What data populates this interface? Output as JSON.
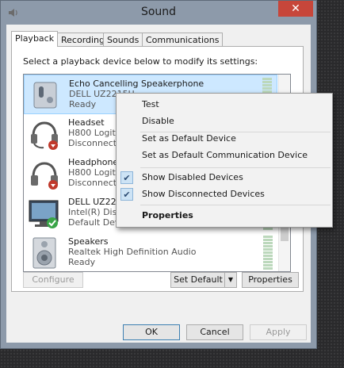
{
  "window": {
    "title": "Sound",
    "close_glyph": "✕"
  },
  "tabs": [
    {
      "label": "Playback",
      "active": true
    },
    {
      "label": "Recording"
    },
    {
      "label": "Sounds"
    },
    {
      "label": "Communications"
    }
  ],
  "instruction": "Select a playback device below to modify its settings:",
  "devices": [
    {
      "name": "Echo Cancelling Speakerphone",
      "desc": "DELL UZ2215H",
      "status": "Ready",
      "icon": "speakerphone-icon",
      "selected": true
    },
    {
      "name": "Headset",
      "desc": "H800 Logite",
      "status": "Disconnect",
      "icon": "headset-icon"
    },
    {
      "name": "Headphone",
      "desc": "H800 Logite",
      "status": "Disconnect",
      "icon": "headphones-icon"
    },
    {
      "name": "DELL UZ221",
      "desc": "Intel(R) Disp",
      "status": "Default Device",
      "icon": "monitor-icon"
    },
    {
      "name": "Speakers",
      "desc": "Realtek High Definition Audio",
      "status": "Ready",
      "icon": "speakers-icon"
    }
  ],
  "context_menu": {
    "test": "Test",
    "disable": "Disable",
    "set_default": "Set as Default Device",
    "set_default_comm": "Set as Default Communication Device",
    "show_disabled": "Show Disabled Devices",
    "show_disconnected": "Show Disconnected Devices",
    "properties": "Properties",
    "check_glyph": "✔"
  },
  "buttons": {
    "configure": "Configure",
    "set_default": "Set Default",
    "set_default_arrow": "▼",
    "properties": "Properties",
    "ok": "OK",
    "cancel": "Cancel",
    "apply": "Apply"
  }
}
